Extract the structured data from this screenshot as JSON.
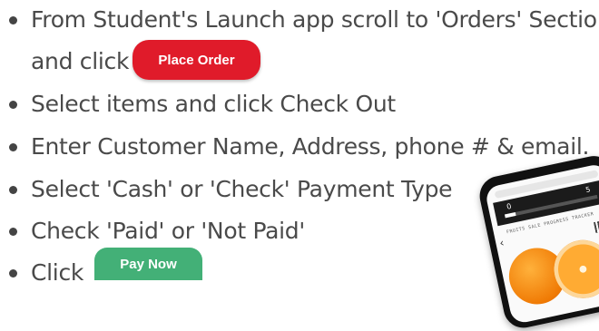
{
  "steps": [
    {
      "line1": "From Student's Launch app scroll to 'Orders' Section",
      "line2": "and click"
    },
    {
      "text": "Select items and click Check Out"
    },
    {
      "text": "Enter Customer Name, Address, phone # & email."
    },
    {
      "text": "Select  'Cash' or 'Check' Payment Type"
    },
    {
      "text": "Check 'Paid' or 'Not Paid'"
    },
    {
      "text": "Click"
    }
  ],
  "buttons": {
    "place_order": "Place Order",
    "pay_now": "Pay Now"
  },
  "phone": {
    "tracker_min": "0",
    "tracker_max": "5",
    "subtitle": "FRUITS SALE PROGRESS TRACKER",
    "nav_prev_icon": "chevron-left-icon",
    "nav_next_icon": "chevron-right-icon"
  },
  "colors": {
    "text": "#4a4a4a",
    "place_order_bg": "#e01b2a",
    "pay_now_bg": "#43b077"
  }
}
